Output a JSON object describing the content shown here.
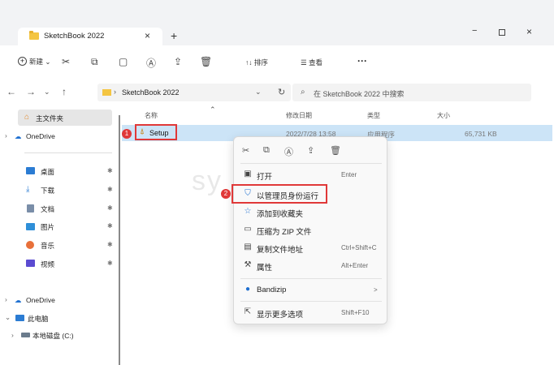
{
  "window": {
    "tab_title": "SketchBook 2022",
    "tab_close": "×",
    "tab_add": "+",
    "min": "−",
    "close": "×"
  },
  "toolbar": {
    "new_label": "新建",
    "new_chevron": "⌄",
    "sort_label": "↑↓ 排序",
    "view_label": "☰ 查看",
    "more": "···"
  },
  "address": {
    "path": "SketchBook 2022",
    "search_placeholder": "在 SketchBook 2022 中搜索"
  },
  "sidebar": {
    "home": "主文件夹",
    "onedrive_top": "OneDrive",
    "items": [
      {
        "label": "桌面",
        "color": "#2b7cd3"
      },
      {
        "label": "下载",
        "color": "#2b7cd3"
      },
      {
        "label": "文档",
        "color": "#7a8ea8"
      },
      {
        "label": "图片",
        "color": "#2f8fd8"
      },
      {
        "label": "音乐",
        "color": "#e8703a"
      },
      {
        "label": "视频",
        "color": "#5b4bd1"
      }
    ],
    "onedrive": "OneDrive",
    "this_pc": "此电脑",
    "local_disk": "本地磁盘 (C:)"
  },
  "columns": {
    "name": "名称",
    "modified": "修改日期",
    "type": "类型",
    "size": "大小"
  },
  "file": {
    "name": "Setup",
    "modified": "2022/7/28 13:58",
    "type": "应用程序",
    "size": "65,731 KB"
  },
  "badges": {
    "one": "1",
    "two": "2"
  },
  "context_menu": {
    "items": [
      {
        "label": "打开",
        "shortcut": "Enter"
      },
      {
        "label": "以管理员身份运行",
        "shortcut": ""
      },
      {
        "label": "添加到收藏夹",
        "shortcut": ""
      },
      {
        "label": "压缩为 ZIP 文件",
        "shortcut": ""
      },
      {
        "label": "复制文件地址",
        "shortcut": "Ctrl+Shift+C"
      },
      {
        "label": "属性",
        "shortcut": "Alt+Enter"
      },
      {
        "label": "Bandizip",
        "shortcut": ">"
      },
      {
        "label": "显示更多选项",
        "shortcut": "Shift+F10"
      }
    ]
  },
  "colors": {
    "accent": "#e03838",
    "selection": "#cce4f7"
  }
}
